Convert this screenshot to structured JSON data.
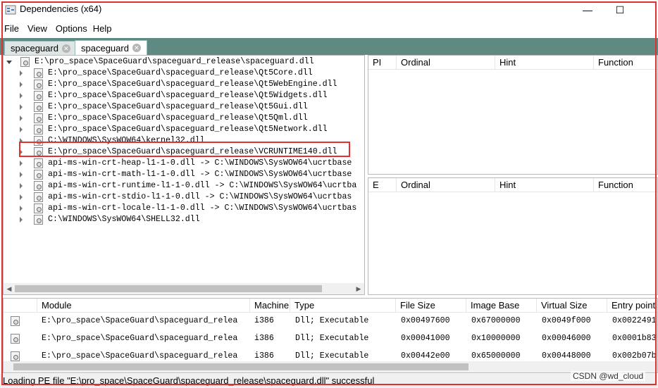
{
  "window": {
    "title": "Dependencies (x64)",
    "minimize_glyph": "—",
    "maximize_glyph": "☐",
    "close_glyph": "✕"
  },
  "menu": [
    "File",
    "View",
    "Options",
    "Help"
  ],
  "tabs": [
    {
      "label": "spaceguard",
      "active": false
    },
    {
      "label": "spaceguard",
      "active": true
    }
  ],
  "tree": [
    {
      "text": "E:\\pro_space\\SpaceGuard\\spaceguard_release\\spaceguard.dll",
      "level": 0,
      "expanded": true
    },
    {
      "text": "E:\\pro_space\\SpaceGuard\\spaceguard_release\\Qt5Core.dll",
      "level": 1
    },
    {
      "text": "E:\\pro_space\\SpaceGuard\\spaceguard_release\\Qt5WebEngine.dll",
      "level": 1
    },
    {
      "text": "E:\\pro_space\\SpaceGuard\\spaceguard_release\\Qt5Widgets.dll",
      "level": 1
    },
    {
      "text": "E:\\pro_space\\SpaceGuard\\spaceguard_release\\Qt5Gui.dll",
      "level": 1
    },
    {
      "text": "E:\\pro_space\\SpaceGuard\\spaceguard_release\\Qt5Qml.dll",
      "level": 1
    },
    {
      "text": "E:\\pro_space\\SpaceGuard\\spaceguard_release\\Qt5Network.dll",
      "level": 1
    },
    {
      "text": "C:\\WINDOWS\\SysWOW64\\kernel32.dll",
      "level": 1
    },
    {
      "text": "E:\\pro_space\\SpaceGuard\\spaceguard_release\\VCRUNTIME140.dll",
      "level": 1
    },
    {
      "text": "api-ms-win-crt-heap-l1-1-0.dll -> C:\\WINDOWS\\SysWOW64\\ucrtbase",
      "level": 1
    },
    {
      "text": "api-ms-win-crt-math-l1-1-0.dll -> C:\\WINDOWS\\SysWOW64\\ucrtbase",
      "level": 1
    },
    {
      "text": "api-ms-win-crt-runtime-l1-1-0.dll -> C:\\WINDOWS\\SysWOW64\\ucrtba",
      "level": 1
    },
    {
      "text": "api-ms-win-crt-stdio-l1-1-0.dll -> C:\\WINDOWS\\SysWOW64\\ucrtbas",
      "level": 1
    },
    {
      "text": "api-ms-win-crt-locale-l1-1-0.dll -> C:\\WINDOWS\\SysWOW64\\ucrtbas",
      "level": 1
    },
    {
      "text": "C:\\WINDOWS\\SysWOW64\\SHELL32.dll",
      "level": 1
    }
  ],
  "imports_table": {
    "columns": [
      "PI",
      "Ordinal",
      "Hint",
      "Function"
    ]
  },
  "exports_table": {
    "columns": [
      "E",
      "Ordinal",
      "Hint",
      "Function"
    ]
  },
  "modules_table": {
    "columns": [
      "",
      "Module",
      "Machine",
      "Type",
      "File Size",
      "Image Base",
      "Virtual Size",
      "Entry point"
    ],
    "rows": [
      [
        "E:\\pro_space\\SpaceGuard\\spaceguard_relea",
        "i386",
        "Dll; Executable",
        "0x00497600",
        "0x67000000",
        "0x0049f000",
        "0x0022491"
      ],
      [
        "E:\\pro_space\\SpaceGuard\\spaceguard_relea",
        "i386",
        "Dll; Executable",
        "0x00041000",
        "0x10000000",
        "0x00046000",
        "0x0001b83"
      ],
      [
        "E:\\pro_space\\SpaceGuard\\spaceguard_relea",
        "i386",
        "Dll; Executable",
        "0x00442e00",
        "0x65000000",
        "0x00448000",
        "0x002b07b"
      ]
    ]
  },
  "status": "Loading PE file \"E:\\pro_space\\SpaceGuard\\spaceguard_release\\spaceguard.dll\" successful",
  "watermark": "CSDN @wd_cloud",
  "colors": {
    "tab_bar": "#5e8a82",
    "highlight": "#e03030"
  }
}
